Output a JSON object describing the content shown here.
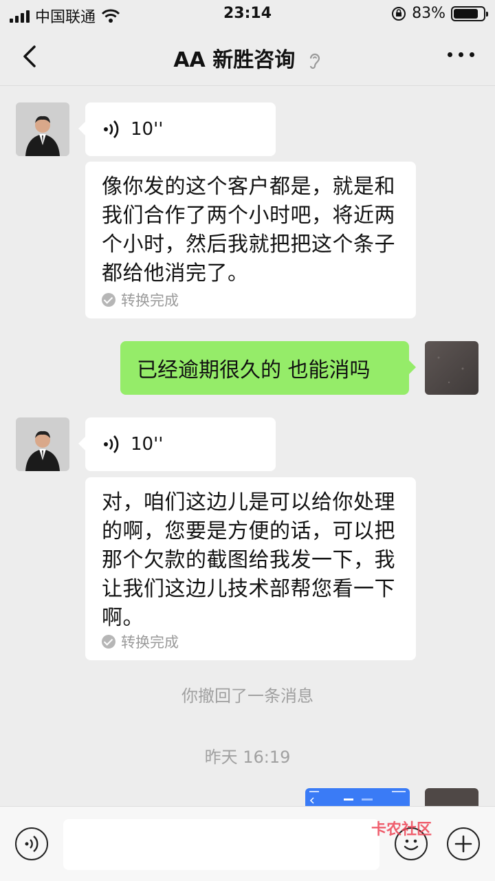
{
  "status": {
    "carrier": "中国联通",
    "time": "23:14",
    "battery": "83%",
    "battery_level": 0.83
  },
  "nav": {
    "title": "AA 新胜咨询"
  },
  "messages": {
    "m1": {
      "duration": "10''",
      "text": "像你发的这个客户都是，就是和我们合作了两个小时吧，将近两个小时，然后我就把把这个条子都给他消完了。",
      "status": "转换完成"
    },
    "m2": {
      "text": "已经逾期很久的 也能消吗"
    },
    "m3": {
      "duration": "10''",
      "text": "对，咱们这边儿是可以给你处理的啊，您要是方便的话，可以把那个欠款的截图给我发一下，我让我们这边儿技术部帮您看一下啊。",
      "status": "转换完成"
    },
    "recall": "你撤回了一条消息",
    "timestamp": "昨天 16:19"
  },
  "watermark": "卡农社区"
}
